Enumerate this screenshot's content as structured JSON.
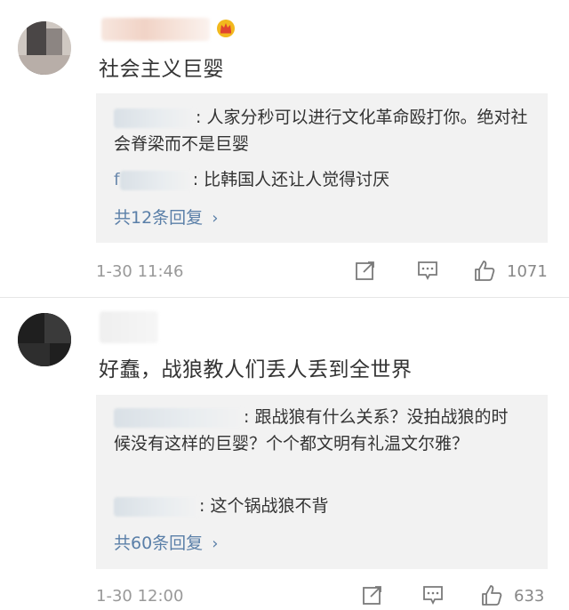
{
  "comments": [
    {
      "text": "社会主义巨婴",
      "replies": [
        {
          "lead": "",
          "text": ": 人家分秒可以进行文化革命殴打你。绝对社会脊梁而不是巨婴"
        },
        {
          "lead": "f",
          "text": ": 比韩国人还让人觉得讨厌"
        }
      ],
      "more_label": "共12条回复",
      "time": "1-30 11:46",
      "likes": "1071"
    },
    {
      "text": "好蠢，战狼教人们丢人丢到全世界",
      "replies": [
        {
          "lead": "",
          "text": ": 跟战狼有什么关系？没拍战狼的时候没有这样的巨婴？个个都文明有礼温文尔雅？"
        },
        {
          "lead": "",
          "text": ": 这个锅战狼不背"
        }
      ],
      "more_label": "共60条回复",
      "time": "1-30 12:00",
      "likes": "633"
    }
  ],
  "colors": {
    "link": "#5a7fa8",
    "reply_bg": "#f2f2f2",
    "meta_text": "#999999",
    "badge": "#f2b81d"
  },
  "icons": [
    "crown-badge-icon",
    "share-icon",
    "comment-icon",
    "like-icon",
    "chevron-right-icon"
  ]
}
